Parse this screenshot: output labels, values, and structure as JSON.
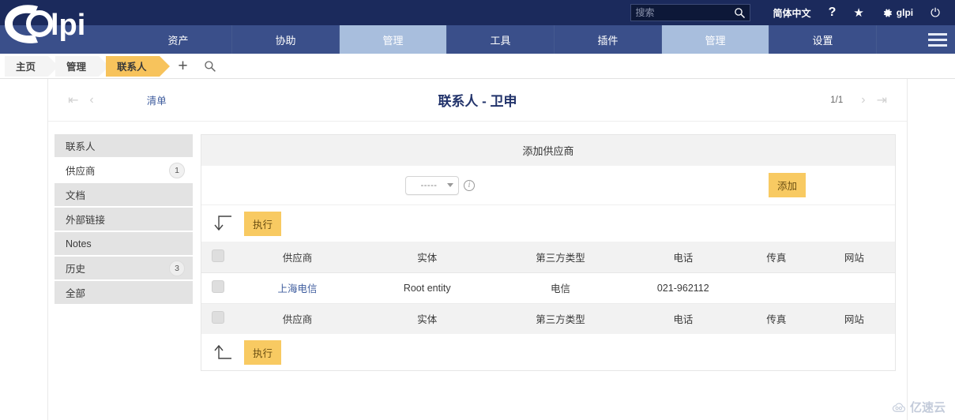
{
  "header": {
    "search_placeholder": "搜索",
    "search_value": "",
    "language": "简体中文",
    "help_icon": "question-mark-icon",
    "favorite_icon": "star-icon",
    "settings_icon": "gear-icon",
    "user": "glpi",
    "power_icon": "power-icon",
    "logo_text": "glpi"
  },
  "nav": {
    "items": [
      {
        "label": "资产",
        "active": false
      },
      {
        "label": "协助",
        "active": false
      },
      {
        "label": "管理",
        "active": true
      },
      {
        "label": "工具",
        "active": false
      },
      {
        "label": "插件",
        "active": false
      },
      {
        "label": "管理",
        "active": true
      },
      {
        "label": "设置",
        "active": false
      }
    ],
    "menu_icon": "hamburger-menu-icon"
  },
  "breadcrumb": {
    "items": [
      {
        "label": "主页",
        "active": false
      },
      {
        "label": "管理",
        "active": false
      },
      {
        "label": "联系人",
        "active": true
      }
    ],
    "add_icon": "plus-icon",
    "search_icon": "search-icon"
  },
  "title_bar": {
    "first_arrow": "first-page-icon",
    "prev_arrow": "previous-page-icon",
    "list_link": "清单",
    "title": "联系人 - 卫申",
    "page_count": "1/1",
    "next_arrow": "next-page-icon",
    "last_arrow": "last-page-icon"
  },
  "sidebar": {
    "items": [
      {
        "label": "联系人",
        "badge": "",
        "selected": false
      },
      {
        "label": "供应商",
        "badge": "1",
        "selected": true
      },
      {
        "label": "文档",
        "badge": "",
        "selected": false
      },
      {
        "label": "外部链接",
        "badge": "",
        "selected": false
      },
      {
        "label": "Notes",
        "badge": "",
        "selected": false
      },
      {
        "label": "历史",
        "badge": "3",
        "selected": false
      },
      {
        "label": "全部",
        "badge": "",
        "selected": false
      }
    ]
  },
  "panel": {
    "heading": "添加供应商",
    "select_value": "-----",
    "info_icon": "info-circle-icon",
    "add_label": "添加",
    "exec_top_label": "执行",
    "exec_bottom_label": "执行",
    "arrow_down_icon": "arrow-down-left-icon",
    "arrow_up_icon": "arrow-up-left-icon"
  },
  "table": {
    "columns": [
      "供应商",
      "实体",
      "第三方类型",
      "电话",
      "传真",
      "网站"
    ],
    "rows": [
      {
        "supplier": "上海电信",
        "entity": "Root entity",
        "type": "电信",
        "phone": "021-962112",
        "fax": "",
        "website": ""
      }
    ]
  },
  "watermark": {
    "text": "亿速云",
    "icon": "cloud-icon"
  },
  "colors": {
    "header_bg": "#1b2a5c",
    "nav_bg": "#3a4f8a",
    "nav_active": "#a8bedd",
    "accent_orange": "#f8ca62",
    "crumb_active": "#f7c35c",
    "link_blue": "#3f5d9e"
  }
}
